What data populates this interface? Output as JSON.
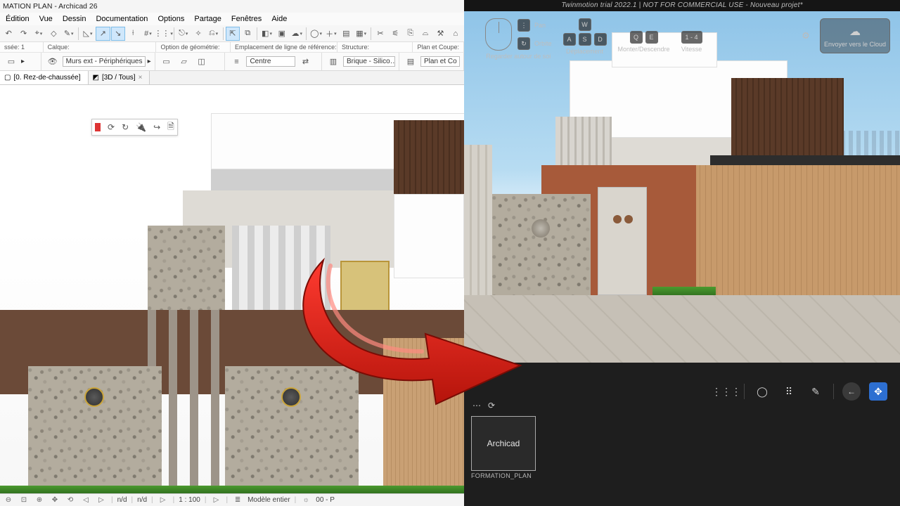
{
  "archicad": {
    "title": "MATION PLAN - Archicad 26",
    "menu": [
      "Édition",
      "Vue",
      "Dessin",
      "Documentation",
      "Options",
      "Partage",
      "Fenêtres",
      "Aide"
    ],
    "optrow": {
      "c1": "ssée: 1",
      "c2": "Calque:",
      "c3": "Option de géométrie:",
      "c4": "Emplacement de ligne de référence:",
      "c5": "Structure:",
      "c6": "Plan et Coupe:"
    },
    "optbar": {
      "layer": "Murs ext - Périphériques",
      "ref": "Centre",
      "struct": "Brique - Silico…",
      "plan": "Plan et Co"
    },
    "tabs": {
      "t1": "[0. Rez-de-chaussée]",
      "t2": "[3D / Tous]"
    },
    "status": {
      "left": [
        "⊖",
        "⊡",
        "⊕",
        "⌕",
        "⊘",
        "▷"
      ],
      "nd1": "n/d",
      "nd2": "n/d",
      "pct": "▷",
      "scale": "1 : 100",
      "pct2": "▷",
      "zoom": "▷",
      "custom": "Modèle entier",
      "right": "00 - P"
    }
  },
  "twin": {
    "title": "Twinmotion trial 2022.1 | NOT FOR COMMERCIAL USE - Nouveau projet*",
    "hud": {
      "pan": "Pan",
      "orbit": "Orbite",
      "look": "Regarder autour de soi",
      "wasd": [
        "W",
        "A",
        "S",
        "D"
      ],
      "move": "Déplacement",
      "qe": [
        "Q",
        "E"
      ],
      "updown": "Monter/Descendre",
      "speed_keys": "1 - 4",
      "speed": "Vitesse",
      "cloud": "Envoyer vers le Cloud"
    },
    "import": {
      "card": "Archicad",
      "caption": "FORMATION_PLAN"
    }
  }
}
